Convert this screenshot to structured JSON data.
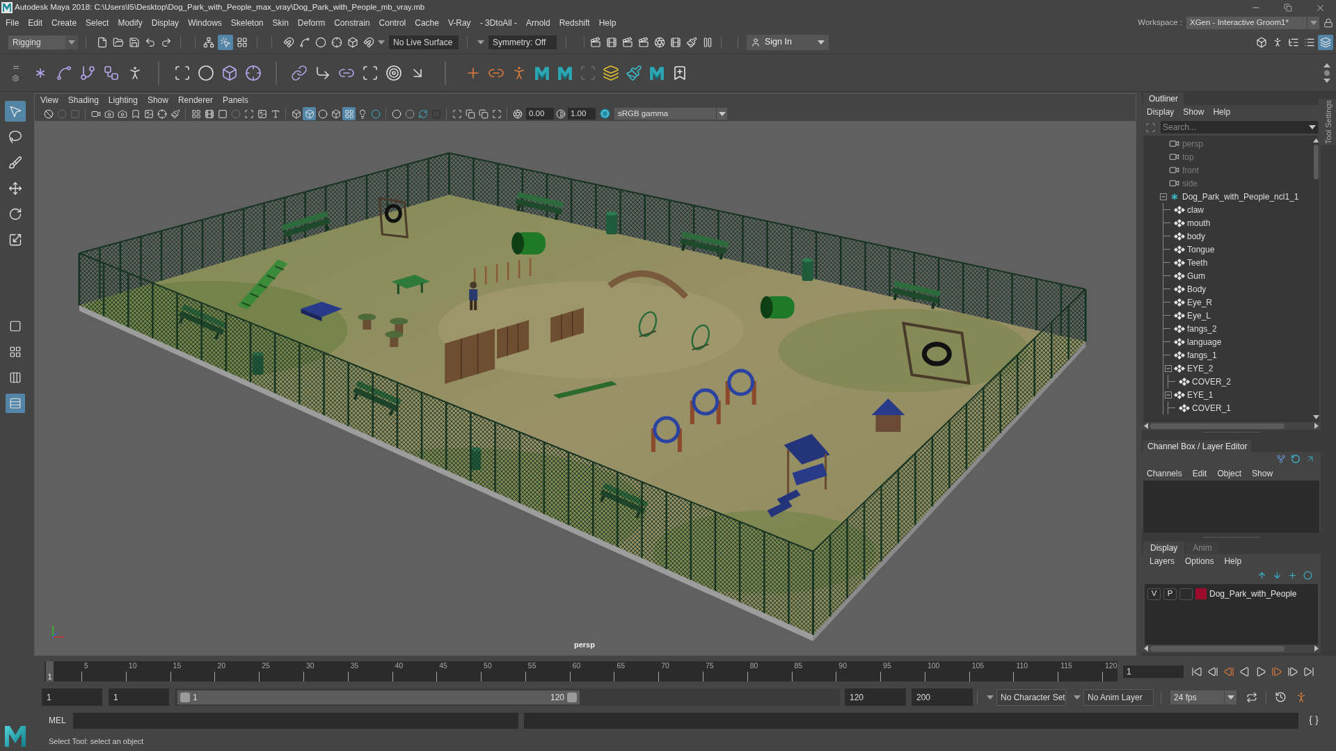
{
  "window": {
    "title": "Autodesk Maya 2018: C:\\Users\\I5\\Desktop\\Dog_Park_with_People_max_vray\\Dog_Park_with_People_mb_vray.mb",
    "workspace_label": "Workspace :",
    "workspace": "XGen - Interactive Groom1*"
  },
  "menu_bar": [
    "File",
    "Edit",
    "Create",
    "Select",
    "Modify",
    "Display",
    "Windows",
    "Skeleton",
    "Skin",
    "Deform",
    "Constrain",
    "Control",
    "Cache",
    "V-Ray",
    "- 3DtoAll -",
    "Arnold",
    "Redshift",
    "Help"
  ],
  "status_line": {
    "menu_set": "Rigging",
    "select_modes": [
      {
        "selected": false
      },
      {
        "selected": true
      },
      {
        "selected": false
      }
    ],
    "live_surface": "No Live Surface",
    "symmetry": "Symmetry: Off",
    "sign_in": "Sign In",
    "panel_toggles": [
      {
        "on": false
      },
      {
        "on": false
      },
      {
        "on": false
      },
      {
        "on": false
      },
      {
        "on": true
      }
    ]
  },
  "toolbox": {
    "tools": [
      {
        "selected": true
      },
      {
        "selected": false
      },
      {
        "selected": false
      },
      {
        "selected": false
      },
      {
        "selected": false
      },
      {
        "selected": false
      }
    ],
    "layouts": [
      {
        "selected": false
      },
      {
        "selected": false
      },
      {
        "selected": false
      },
      {
        "selected": true
      }
    ]
  },
  "viewport": {
    "menus": [
      "View",
      "Shading",
      "Lighting",
      "Show",
      "Renderer",
      "Panels"
    ],
    "shading_toggles": [
      {
        "on": false
      },
      {
        "on": true
      },
      {
        "on": false
      },
      {
        "on": false
      },
      {
        "on": true
      }
    ],
    "exposure": "0.00",
    "gamma": "1.00",
    "color_space": "sRGB gamma",
    "camera": "persp"
  },
  "outliner": {
    "title": "Outliner",
    "menus": [
      "Display",
      "Show",
      "Help"
    ],
    "search_placeholder": "Search...",
    "items": [
      {
        "label": "persp",
        "kind": "camera"
      },
      {
        "label": "top",
        "kind": "camera"
      },
      {
        "label": "front",
        "kind": "camera"
      },
      {
        "label": "side",
        "kind": "camera"
      },
      {
        "label": "Dog_Park_with_People_ncl1_1",
        "kind": "group",
        "expanded": true,
        "children": [
          {
            "label": "claw",
            "kind": "mesh"
          },
          {
            "label": "mouth",
            "kind": "mesh"
          },
          {
            "label": "body",
            "kind": "mesh"
          },
          {
            "label": "Tongue",
            "kind": "mesh"
          },
          {
            "label": "Teeth",
            "kind": "mesh"
          },
          {
            "label": "Gum",
            "kind": "mesh"
          },
          {
            "label": "Body",
            "kind": "mesh"
          },
          {
            "label": "Eye_R",
            "kind": "mesh"
          },
          {
            "label": "Eye_L",
            "kind": "mesh"
          },
          {
            "label": "fangs_2",
            "kind": "mesh"
          },
          {
            "label": "language",
            "kind": "mesh"
          },
          {
            "label": "fangs_1",
            "kind": "mesh"
          },
          {
            "label": "EYE_2",
            "kind": "mesh",
            "expanded": true,
            "children": [
              {
                "label": "COVER_2",
                "kind": "mesh"
              }
            ]
          },
          {
            "label": "EYE_1",
            "kind": "mesh",
            "expanded": true,
            "children": [
              {
                "label": "COVER_1",
                "kind": "mesh"
              }
            ]
          }
        ]
      }
    ]
  },
  "channel_box": {
    "title": "Channel Box / Layer Editor",
    "menus": [
      "Channels",
      "Edit",
      "Object",
      "Show"
    ]
  },
  "layer_editor": {
    "tabs": [
      {
        "label": "Display",
        "selected": true
      },
      {
        "label": "Anim",
        "selected": false
      }
    ],
    "menus": [
      "Layers",
      "Options",
      "Help"
    ],
    "layers": [
      {
        "visibility": "V",
        "playback": "P",
        "name": "Dog_Park_with_People",
        "color": "#9c0a2c"
      }
    ]
  },
  "tool_settings_tab": "Tool Settings",
  "time_slider": {
    "ticks": [
      "5",
      "10",
      "15",
      "20",
      "25",
      "30",
      "35",
      "40",
      "45",
      "50",
      "55",
      "60",
      "65",
      "70",
      "75",
      "80",
      "85",
      "90",
      "95",
      "100",
      "105",
      "110",
      "115",
      "120"
    ],
    "level": 0,
    "playhead": "1",
    "current_frame": "1"
  },
  "range_slider": {
    "animation_start": "1",
    "playback_start": "1",
    "range_start": "1",
    "range_end": "120",
    "playback_end": "120",
    "animation_end": "200",
    "character_set": "No Character Set",
    "anim_layer": "No Anim Layer",
    "fps": "24 fps"
  },
  "command_line": {
    "label": "MEL"
  },
  "help_line": "Select Tool: select an object"
}
